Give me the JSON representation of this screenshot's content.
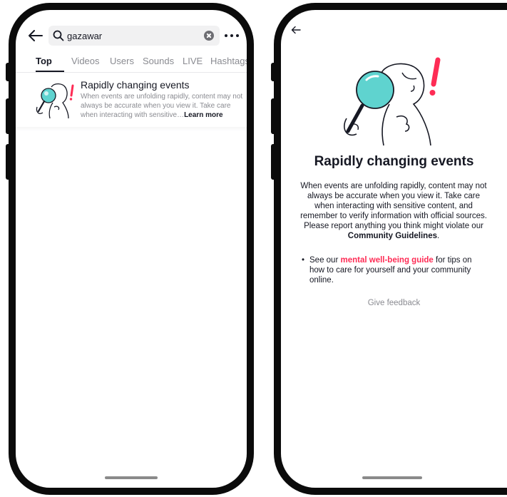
{
  "search": {
    "query": "gazawar"
  },
  "tabs": [
    {
      "label": "Top",
      "active": true
    },
    {
      "label": "Videos",
      "active": false
    },
    {
      "label": "Users",
      "active": false
    },
    {
      "label": "Sounds",
      "active": false
    },
    {
      "label": "LIVE",
      "active": false
    },
    {
      "label": "Hashtags",
      "active": false
    }
  ],
  "notice": {
    "title": "Rapidly changing events",
    "body": "When events are unfolding rapidly, content may not always be accurate when you view it. Take care when interacting with sensitive…",
    "learn_more": "Learn more"
  },
  "info": {
    "title": "Rapidly changing events",
    "body_intro": "When events are unfolding rapidly, content may not always be accurate when you view it. Take care when interacting with sensitive content, and remember to verify information with official sources. Please report anything you think might violate our ",
    "guidelines_link": "Community Guidelines",
    "body_end": ".",
    "tips_bullet": "•",
    "tips_prefix": "See our ",
    "tips_link": "mental well-being guide",
    "tips_suffix": " for tips on how to care for yourself and your community online.",
    "feedback": "Give feedback"
  },
  "colors": {
    "accent": "#fe2c55",
    "magnifier": "#5fd3cf",
    "text_primary": "#161823",
    "text_secondary": "#8a8b91"
  },
  "icons": {
    "back": "arrow-left-icon",
    "search": "search-icon",
    "clear": "clear-icon",
    "more": "more-icon"
  }
}
